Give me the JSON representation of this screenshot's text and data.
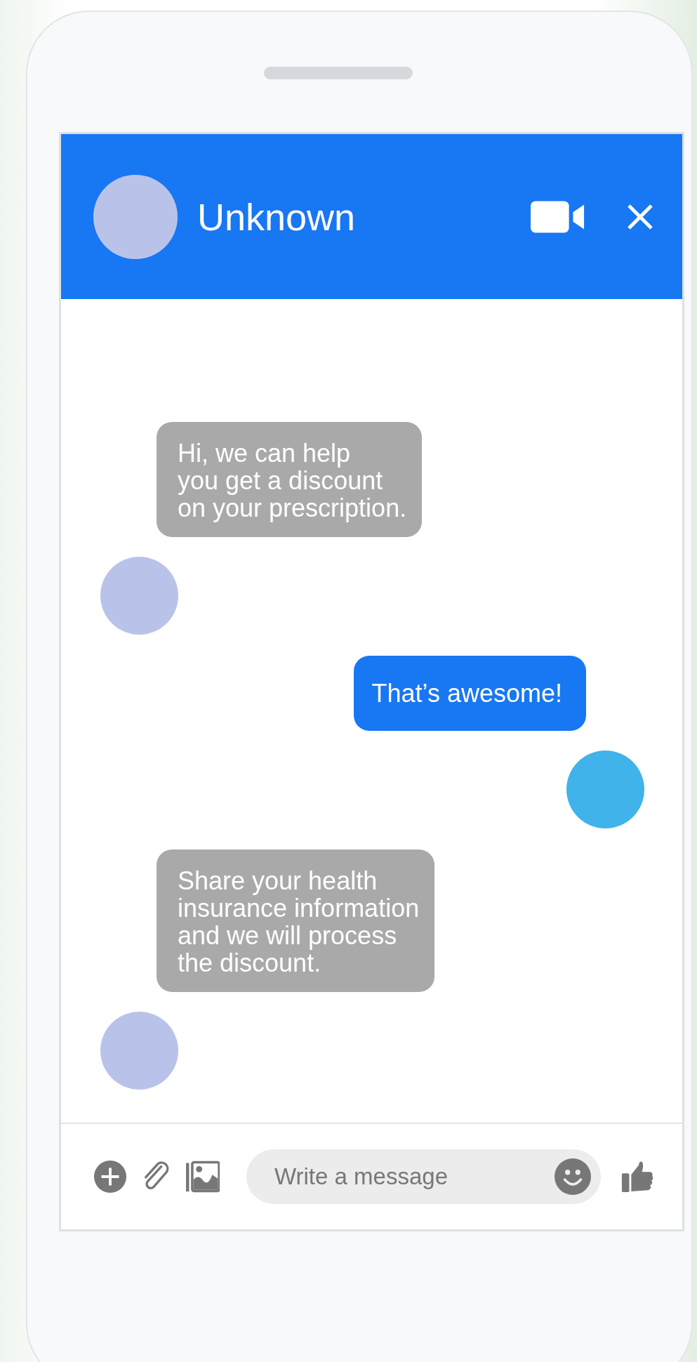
{
  "header": {
    "contact_name": "Unknown"
  },
  "messages": [
    {
      "kind": "incoming",
      "lines": [
        "Hi, we can help",
        "you get a discount",
        "on your prescription."
      ]
    },
    {
      "kind": "outgoing",
      "lines": [
        "That’s awesome!"
      ]
    },
    {
      "kind": "incoming",
      "lines": [
        "Share your health",
        "insurance information",
        "and we will process",
        "the discount."
      ]
    }
  ],
  "composer": {
    "placeholder": "Write a message"
  }
}
